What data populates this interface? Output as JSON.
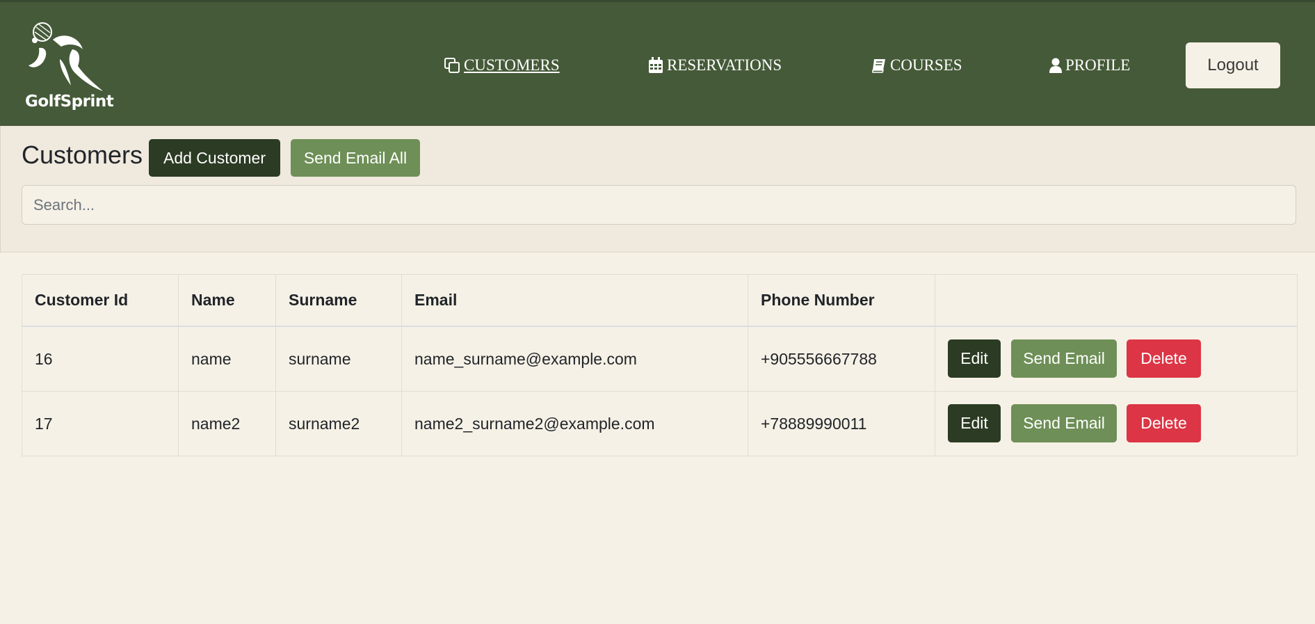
{
  "brand": {
    "name": "GolfSprint",
    "logo_icon": "golfer-logo-icon"
  },
  "nav": {
    "items": [
      {
        "label": "CUSTOMERS",
        "icon": "copy-icon",
        "active": true
      },
      {
        "label": "RESERVATIONS",
        "icon": "calendar-icon",
        "active": false
      },
      {
        "label": "COURSES",
        "icon": "book-icon",
        "active": false
      },
      {
        "label": "PROFILE",
        "icon": "user-icon",
        "active": false
      }
    ],
    "logout_label": "Logout"
  },
  "page": {
    "title": "Customers",
    "add_label": "Add Customer",
    "send_all_label": "Send Email All",
    "search_placeholder": "Search...",
    "search_value": ""
  },
  "table": {
    "columns": [
      "Customer Id",
      "Name",
      "Surname",
      "Email",
      "Phone Number",
      ""
    ],
    "rows": [
      {
        "id": "16",
        "name": "name",
        "surname": "surname",
        "email": "name_surname@example.com",
        "phone": "+905556667788"
      },
      {
        "id": "17",
        "name": "name2",
        "surname": "surname2",
        "email": "name2_surname2@example.com",
        "phone": "+78889990011"
      }
    ],
    "actions": {
      "edit": "Edit",
      "send_email": "Send Email",
      "delete": "Delete"
    }
  },
  "colors": {
    "header_bg": "#455a38",
    "page_bg": "#f6f1e6",
    "panel_bg": "#efe9de",
    "btn_dark": "#2c3b23",
    "btn_green": "#6e8f57",
    "btn_red": "#dc3545"
  }
}
